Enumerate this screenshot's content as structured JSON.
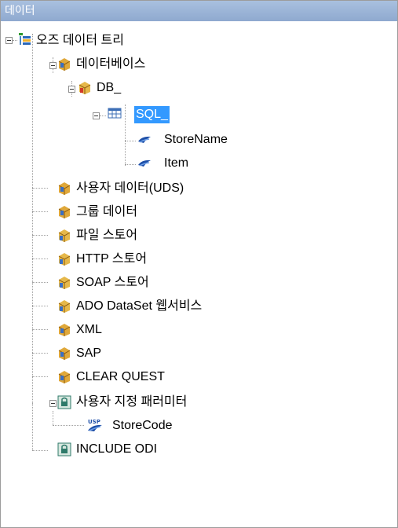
{
  "panel": {
    "title": "데이터"
  },
  "tree": {
    "root": "오즈 데이터 트리",
    "database": "데이터베이스",
    "db": "DB_",
    "sql": "SQL_",
    "field_storename": "StoreName",
    "field_item": "Item",
    "user_data": "사용자 데이터(UDS)",
    "group_data": "그룹 데이터",
    "file_store": "파일 스토어",
    "http_store": "HTTP 스토어",
    "soap_store": "SOAP 스토어",
    "ado_ws": "ADO DataSet 웹서비스",
    "xml": "XML",
    "sap": "SAP",
    "clearquest": "CLEAR QUEST",
    "user_params": "사용자 지정 패러미터",
    "param_storecode": "StoreCode",
    "include_odi": "INCLUDE ODI"
  },
  "colors": {
    "selection": "#3399ff",
    "title_bar": "#9db4d9"
  }
}
